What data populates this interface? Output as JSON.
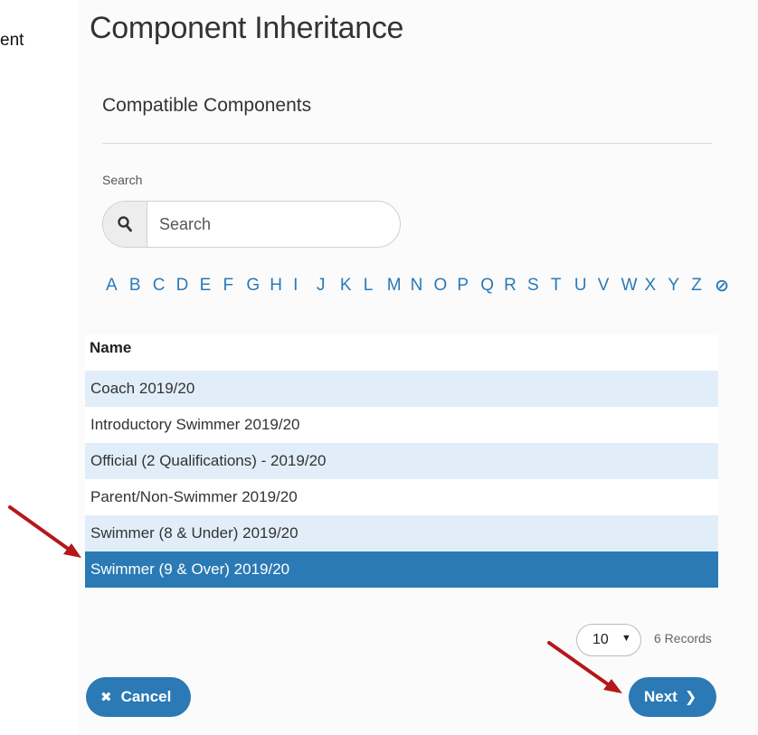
{
  "left_fragment": "ent",
  "page": {
    "title": "Component Inheritance",
    "subtitle": "Compatible Components"
  },
  "search": {
    "label": "Search",
    "placeholder": "Search",
    "icon": "search-icon"
  },
  "alphabet": [
    "A",
    "B",
    "C",
    "D",
    "E",
    "F",
    "G",
    "H",
    "I",
    "J",
    "K",
    "L",
    "M",
    "N",
    "O",
    "P",
    "Q",
    "R",
    "S",
    "T",
    "U",
    "V",
    "W",
    "X",
    "Y",
    "Z"
  ],
  "alphabet_clear_glyph": "⊘",
  "table": {
    "header": "Name",
    "rows": [
      "Coach 2019/20",
      "Introductory Swimmer 2019/20",
      "Official (2 Qualifications) - 2019/20",
      "Parent/Non-Swimmer 2019/20",
      "Swimmer (8 & Under) 2019/20",
      "Swimmer (9 & Over) 2019/20"
    ],
    "selected_row": "Swimmer (9 & Over) 2019/20"
  },
  "pagination": {
    "page_size": "10",
    "page_size_caret": "▼",
    "record_count": "6 Records"
  },
  "buttons": {
    "cancel_label": "Cancel",
    "cancel_icon": "✖",
    "next_label": "Next",
    "next_icon": "❯"
  },
  "colors": {
    "accent": "#2b7ab5",
    "row_alt": "#e1eef9",
    "annotation_arrow": "#b5171a"
  }
}
